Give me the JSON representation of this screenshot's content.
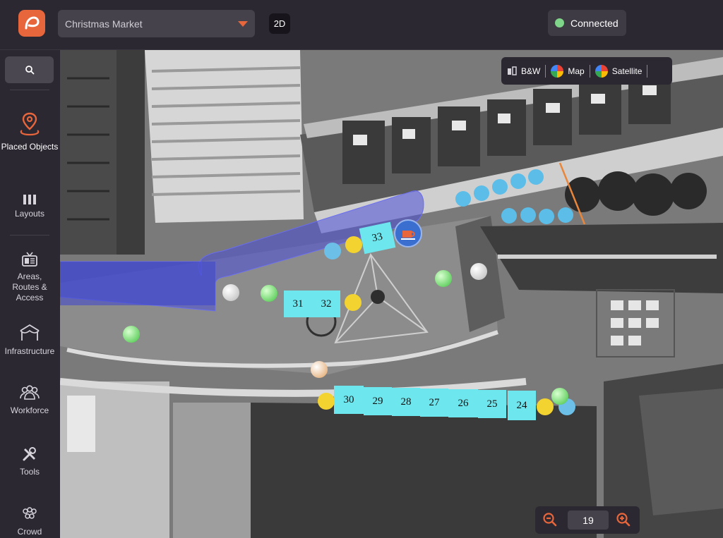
{
  "header": {
    "project_name": "Christmas Market",
    "view_mode": "2D",
    "status_text": "Connected",
    "status_color": "#7fd58a",
    "brand_color": "#e8663b"
  },
  "sidebar": {
    "search_icon": "search-icon",
    "items": [
      {
        "label": "Placed Objects",
        "icon": "map-pin-icon",
        "active": true
      },
      {
        "label": "Layouts",
        "icon": "columns-icon"
      },
      {
        "label": "Areas, Routes & Access",
        "icon": "tv-ticket-icon"
      },
      {
        "label": "Infrastructure",
        "icon": "tent-icon"
      },
      {
        "label": "Workforce",
        "icon": "people-icon"
      },
      {
        "label": "Tools",
        "icon": "tools-icon"
      },
      {
        "label": "Crowd",
        "icon": "crowd-icon"
      }
    ]
  },
  "map": {
    "layers": [
      {
        "label": "B&W",
        "icon": "bw-layer-icon"
      },
      {
        "label": "Map",
        "icon": "google-icon"
      },
      {
        "label": "Satellite",
        "icon": "google-icon"
      }
    ],
    "zoom_level": "19",
    "stalls": [
      "33",
      "31",
      "32",
      "30",
      "29",
      "28",
      "27",
      "26",
      "25",
      "24"
    ],
    "highlight_area_color": "#4a4fd8",
    "stall_color": "#6ee6ee"
  }
}
